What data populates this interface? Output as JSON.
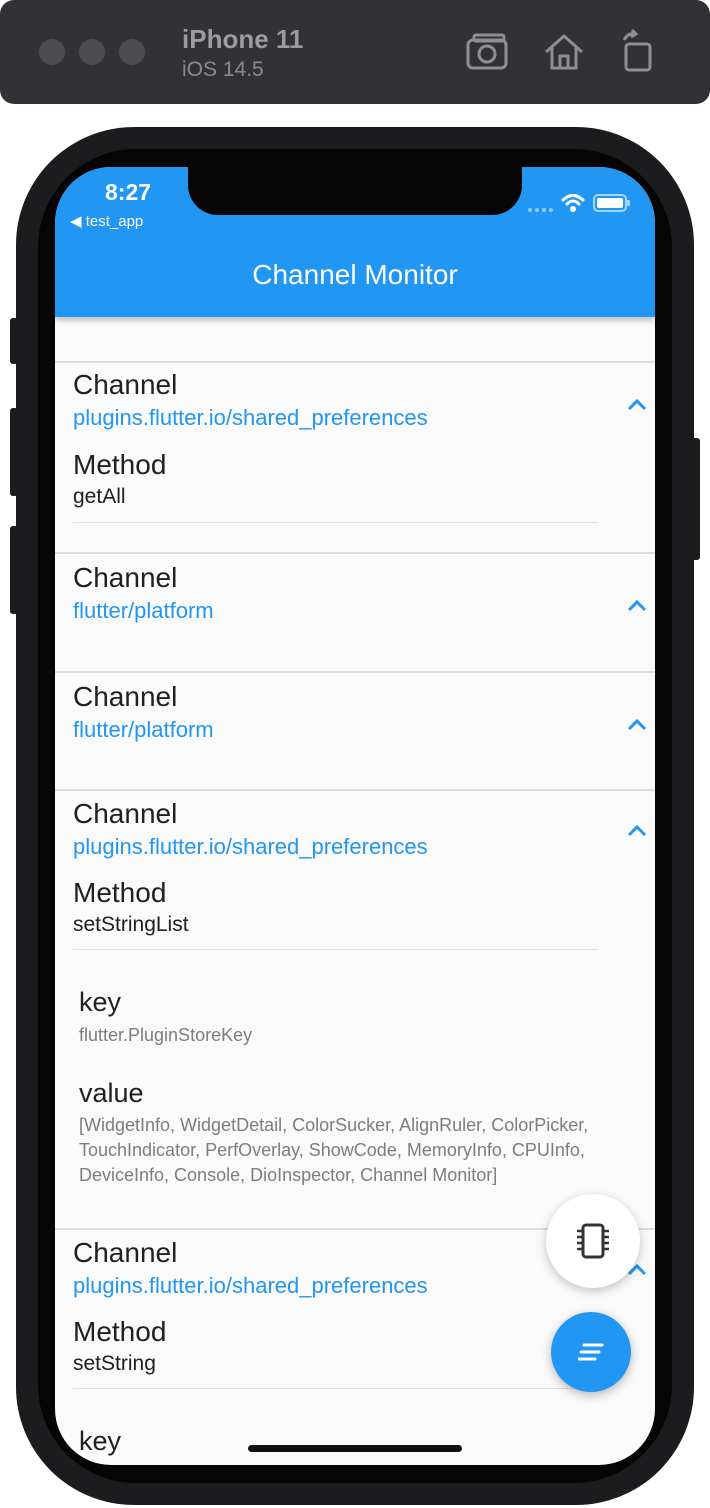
{
  "simulator": {
    "device_name": "iPhone 11",
    "os_version": "iOS 14.5",
    "icons": [
      "screenshot-icon",
      "home-icon",
      "rotate-icon"
    ]
  },
  "status_bar": {
    "time": "8:27",
    "back_app": "◀ test_app"
  },
  "appbar": {
    "title": "Channel Monitor"
  },
  "entries": [
    {
      "channel_label": "Channel",
      "channel": "plugins.flutter.io/shared_preferences",
      "method_label": "Method",
      "method": "getAll"
    },
    {
      "channel_label": "Channel",
      "channel": "flutter/platform"
    },
    {
      "channel_label": "Channel",
      "channel": "flutter/platform"
    },
    {
      "channel_label": "Channel",
      "channel": "plugins.flutter.io/shared_preferences",
      "method_label": "Method",
      "method": "setStringList",
      "args": [
        {
          "key": "key",
          "value": "flutter.PluginStoreKey"
        },
        {
          "key": "value",
          "value": "[WidgetInfo, WidgetDetail, ColorSucker, AlignRuler, ColorPicker, TouchIndicator, PerfOverlay, ShowCode, MemoryInfo, CPUInfo, DeviceInfo, Console, DioInspector, Channel Monitor]"
        }
      ]
    },
    {
      "channel_label": "Channel",
      "channel": "plugins.flutter.io/shared_preferences",
      "method_label": "Method",
      "method": "setString",
      "args": [
        {
          "key": "key"
        }
      ]
    }
  ],
  "colors": {
    "accent": "#2196f3",
    "background": "#fafafa",
    "frame": "#1c1c1e"
  }
}
